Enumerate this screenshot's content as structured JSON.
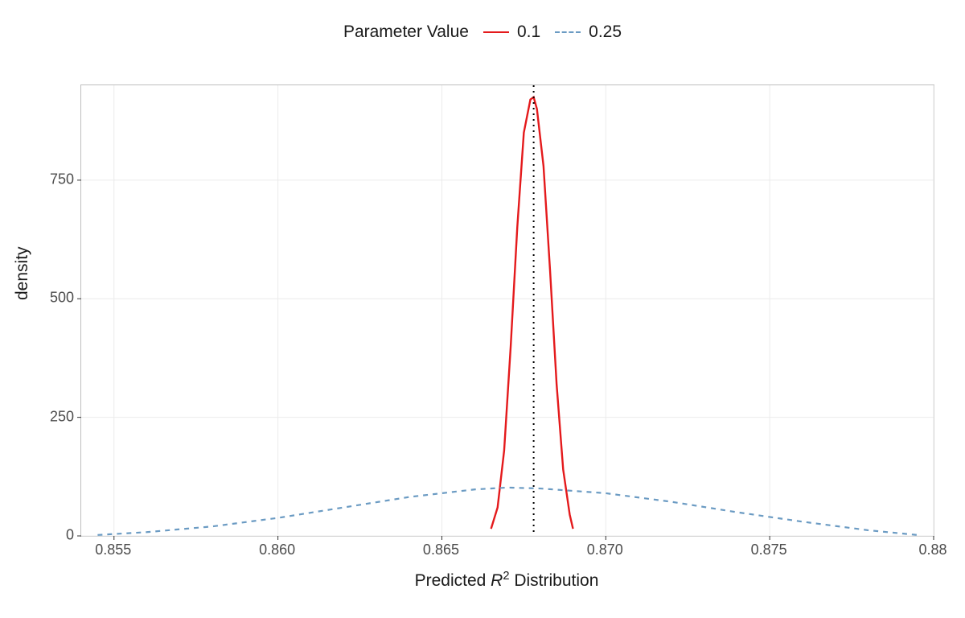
{
  "legend": {
    "title": "Parameter Value",
    "items": [
      {
        "label": "0.1",
        "style": "solid-red"
      },
      {
        "label": "0.25",
        "style": "dash-blue"
      }
    ]
  },
  "axes": {
    "ylab": "density",
    "xlab_prefix": "Predicted ",
    "xlab_var": "R",
    "xlab_sup": "2",
    "xlab_suffix": " Distribution",
    "x_ticks": [
      "0.855",
      "0.860",
      "0.865",
      "0.870",
      "0.875",
      "0.88"
    ],
    "x_tick_vals": [
      0.855,
      0.86,
      0.865,
      0.87,
      0.875,
      0.88
    ],
    "y_ticks": [
      "0",
      "250",
      "500",
      "750"
    ],
    "y_tick_vals": [
      0,
      250,
      500,
      750
    ]
  },
  "colors": {
    "series_red": "#e41a1c",
    "series_blue": "#6b9bc3",
    "grid": "#ebebeb",
    "panel_border": "#bfbfbf",
    "vline": "#000000"
  },
  "chart_data": {
    "type": "line",
    "title": "",
    "xlabel": "Predicted R² Distribution",
    "ylabel": "density",
    "xlim": [
      0.854,
      0.88
    ],
    "ylim": [
      0,
      950
    ],
    "vline_x": 0.8678,
    "series": [
      {
        "name": "0.1",
        "style": "solid",
        "color": "#e41a1c",
        "x": [
          0.8665,
          0.8667,
          0.8669,
          0.8671,
          0.8673,
          0.8675,
          0.8677,
          0.8678,
          0.8679,
          0.8681,
          0.8683,
          0.8685,
          0.8687,
          0.8689,
          0.869
        ],
        "y": [
          15,
          60,
          180,
          400,
          650,
          850,
          920,
          925,
          900,
          780,
          560,
          320,
          140,
          45,
          15
        ]
      },
      {
        "name": "0.25",
        "style": "dashed",
        "color": "#6b9bc3",
        "x": [
          0.8545,
          0.856,
          0.858,
          0.86,
          0.862,
          0.864,
          0.866,
          0.867,
          0.868,
          0.87,
          0.872,
          0.874,
          0.876,
          0.878,
          0.8795
        ],
        "y": [
          2,
          8,
          20,
          38,
          60,
          82,
          98,
          102,
          100,
          90,
          72,
          50,
          30,
          12,
          2
        ]
      }
    ]
  }
}
